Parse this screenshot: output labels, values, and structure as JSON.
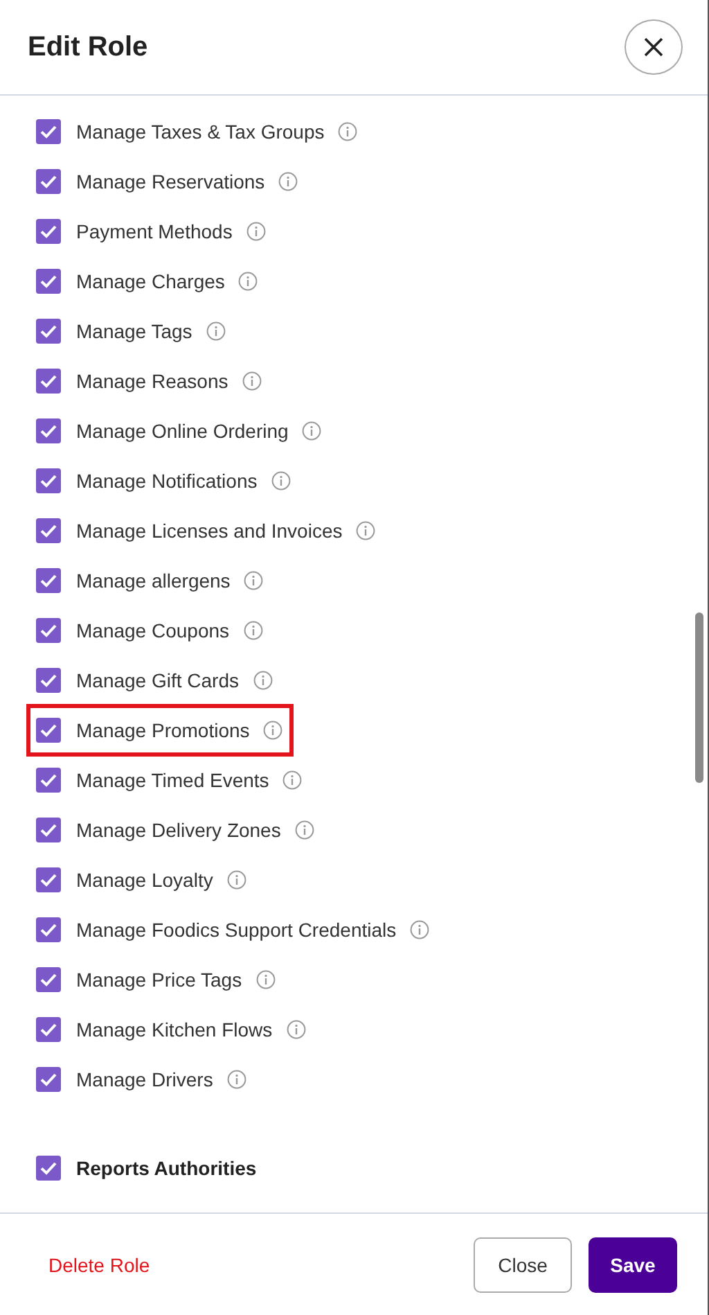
{
  "dialog": {
    "title": "Edit Role"
  },
  "sections": [
    {
      "items": [
        {
          "label": "Manage Taxes & Tax Groups",
          "checked": true,
          "highlighted": false
        },
        {
          "label": "Manage Reservations",
          "checked": true,
          "highlighted": false
        },
        {
          "label": "Payment Methods",
          "checked": true,
          "highlighted": false
        },
        {
          "label": "Manage Charges",
          "checked": true,
          "highlighted": false
        },
        {
          "label": "Manage Tags",
          "checked": true,
          "highlighted": false
        },
        {
          "label": "Manage Reasons",
          "checked": true,
          "highlighted": false
        },
        {
          "label": "Manage Online Ordering",
          "checked": true,
          "highlighted": false
        },
        {
          "label": "Manage Notifications",
          "checked": true,
          "highlighted": false
        },
        {
          "label": "Manage Licenses and Invoices",
          "checked": true,
          "highlighted": false
        },
        {
          "label": "Manage allergens",
          "checked": true,
          "highlighted": false
        },
        {
          "label": "Manage Coupons",
          "checked": true,
          "highlighted": false
        },
        {
          "label": "Manage Gift Cards",
          "checked": true,
          "highlighted": false
        },
        {
          "label": "Manage Promotions",
          "checked": true,
          "highlighted": true
        },
        {
          "label": "Manage Timed Events",
          "checked": true,
          "highlighted": false
        },
        {
          "label": "Manage Delivery Zones",
          "checked": true,
          "highlighted": false
        },
        {
          "label": "Manage Loyalty",
          "checked": true,
          "highlighted": false
        },
        {
          "label": "Manage Foodics Support Credentials",
          "checked": true,
          "highlighted": false
        },
        {
          "label": "Manage Price Tags",
          "checked": true,
          "highlighted": false
        },
        {
          "label": "Manage Kitchen Flows",
          "checked": true,
          "highlighted": false
        },
        {
          "label": "Manage Drivers",
          "checked": true,
          "highlighted": false
        }
      ]
    },
    {
      "title": "Reports Authorities",
      "checked": true
    }
  ],
  "footer": {
    "delete": "Delete Role",
    "close": "Close",
    "save": "Save"
  }
}
